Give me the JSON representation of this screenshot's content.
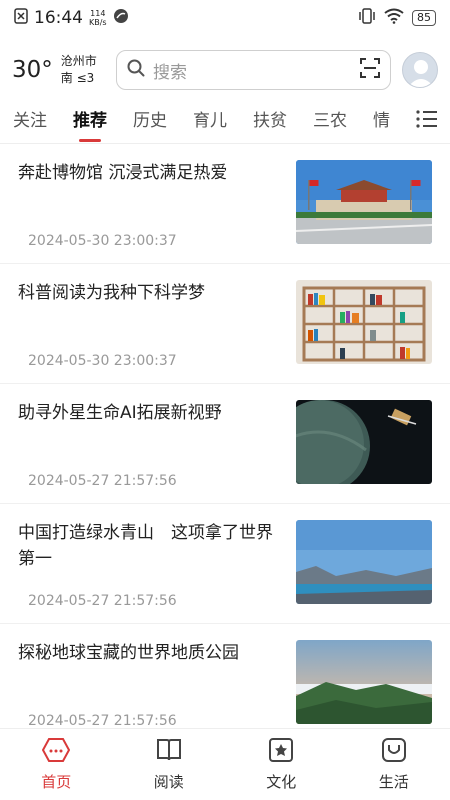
{
  "status": {
    "time": "16:44",
    "net_speed_value": "114",
    "net_speed_unit": "KB/s",
    "battery": "85"
  },
  "header": {
    "temperature": "30°",
    "city": "沧州市",
    "wind": "南 ≤3",
    "search_placeholder": "搜索"
  },
  "tabs": [
    "关注",
    "推荐",
    "历史",
    "育儿",
    "扶贫",
    "三农",
    "情"
  ],
  "active_tab": "推荐",
  "feed": [
    {
      "title": "奔赴博物馆 沉浸式满足热爱",
      "date": "2024-05-30 23:00:37",
      "image": "museum-photo"
    },
    {
      "title": "科普阅读为我种下科学梦",
      "date": "2024-05-30 23:00:37",
      "image": "bookshelf-photo"
    },
    {
      "title": "助寻外星生命AI拓展新视野",
      "date": "2024-05-27 21:57:56",
      "image": "planet-photo"
    },
    {
      "title": "中国打造绿水青山　这项拿了世界第一",
      "date": "2024-05-27 21:57:56",
      "image": "lake-mountain-photo"
    },
    {
      "title": "探秘地球宝藏的世界地质公园",
      "date": "2024-05-27 21:57:56",
      "image": "geopark-photo"
    }
  ],
  "navbar": [
    {
      "label": "首页",
      "icon": "home-icon",
      "active": true
    },
    {
      "label": "阅读",
      "icon": "book-icon",
      "active": false
    },
    {
      "label": "文化",
      "icon": "culture-icon",
      "active": false
    },
    {
      "label": "生活",
      "icon": "life-icon",
      "active": false
    }
  ],
  "colors": {
    "accent": "#d93a3a"
  }
}
